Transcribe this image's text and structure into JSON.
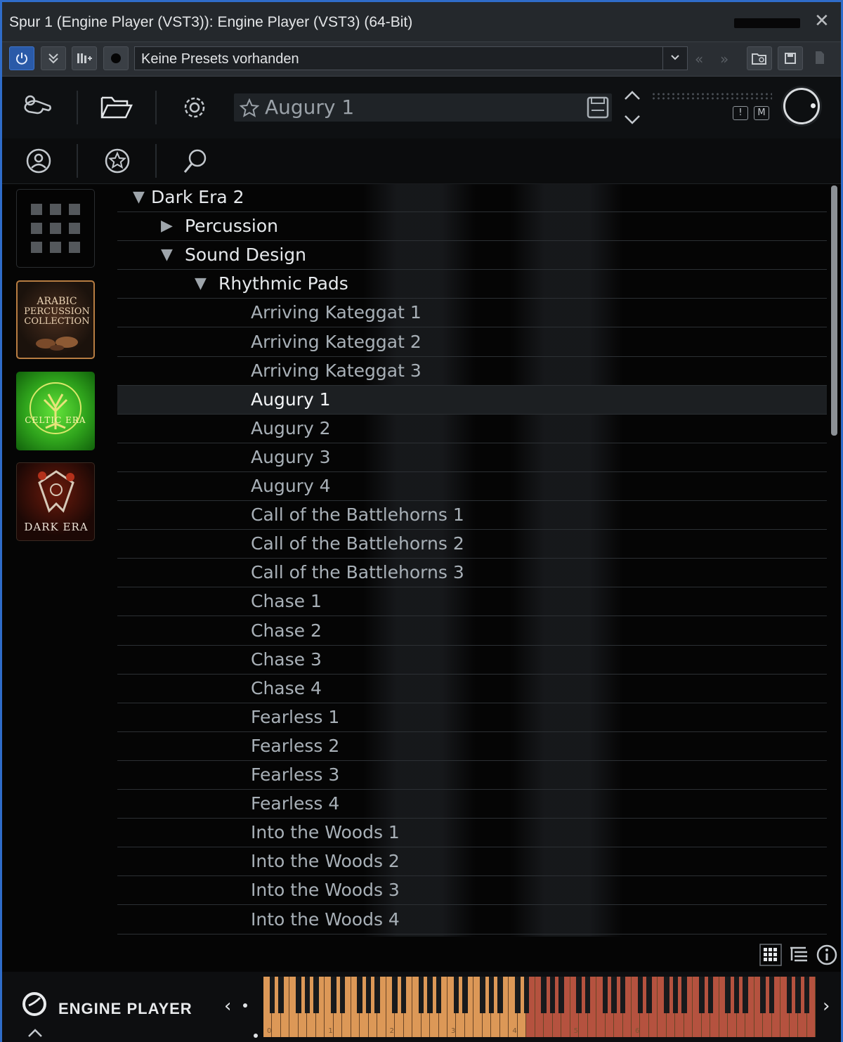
{
  "window": {
    "title": "Spur 1 (Engine Player (VST3)): Engine Player (VST3) (64-Bit)",
    "close_glyph": "✕"
  },
  "host_toolbar": {
    "preset_label": "Keine Presets vorhanden",
    "accent_color": "#2f6cc9"
  },
  "plugin": {
    "patch_name": "Augury 1",
    "solo_label": "!",
    "mute_label": "M",
    "brand": "ENGINE PLAYER"
  },
  "libraries": [
    {
      "name": "grid-view",
      "icon": "grid-icon"
    },
    {
      "name": "ARABIC PERCUSSION COLLECTION",
      "line1": "ARABIC",
      "line2": "PERCUSSION",
      "line3": "COLLECTION"
    },
    {
      "name": "CELTIC ERA",
      "label": "CELTIC ERA"
    },
    {
      "name": "DARK ERA",
      "label": "DARK ERA"
    }
  ],
  "tree": {
    "root": "Dark Era 2",
    "folders": [
      "Percussion",
      "Sound Design",
      "Rhythmic Pads"
    ],
    "patches": [
      "Arriving Kateggat 1",
      "Arriving Kateggat 2",
      "Arriving Kateggat 3",
      "Augury 1",
      "Augury 2",
      "Augury 3",
      "Augury 4",
      "Call of the Battlehorns 1",
      "Call of the Battlehorns 2",
      "Call of the Battlehorns 3",
      "Chase 1",
      "Chase 2",
      "Chase 3",
      "Chase 4",
      "Fearless 1",
      "Fearless 2",
      "Fearless 3",
      "Fearless 4",
      "Into the Woods 1",
      "Into the Woods 2",
      "Into the Woods 3",
      "Into the Woods 4"
    ],
    "selected": "Augury 1"
  },
  "keyboard": {
    "octave_labels": [
      "0",
      "1",
      "2",
      "3",
      "4",
      "5",
      "6"
    ],
    "low_color": "#dc9857",
    "high_color": "#b5523f"
  }
}
